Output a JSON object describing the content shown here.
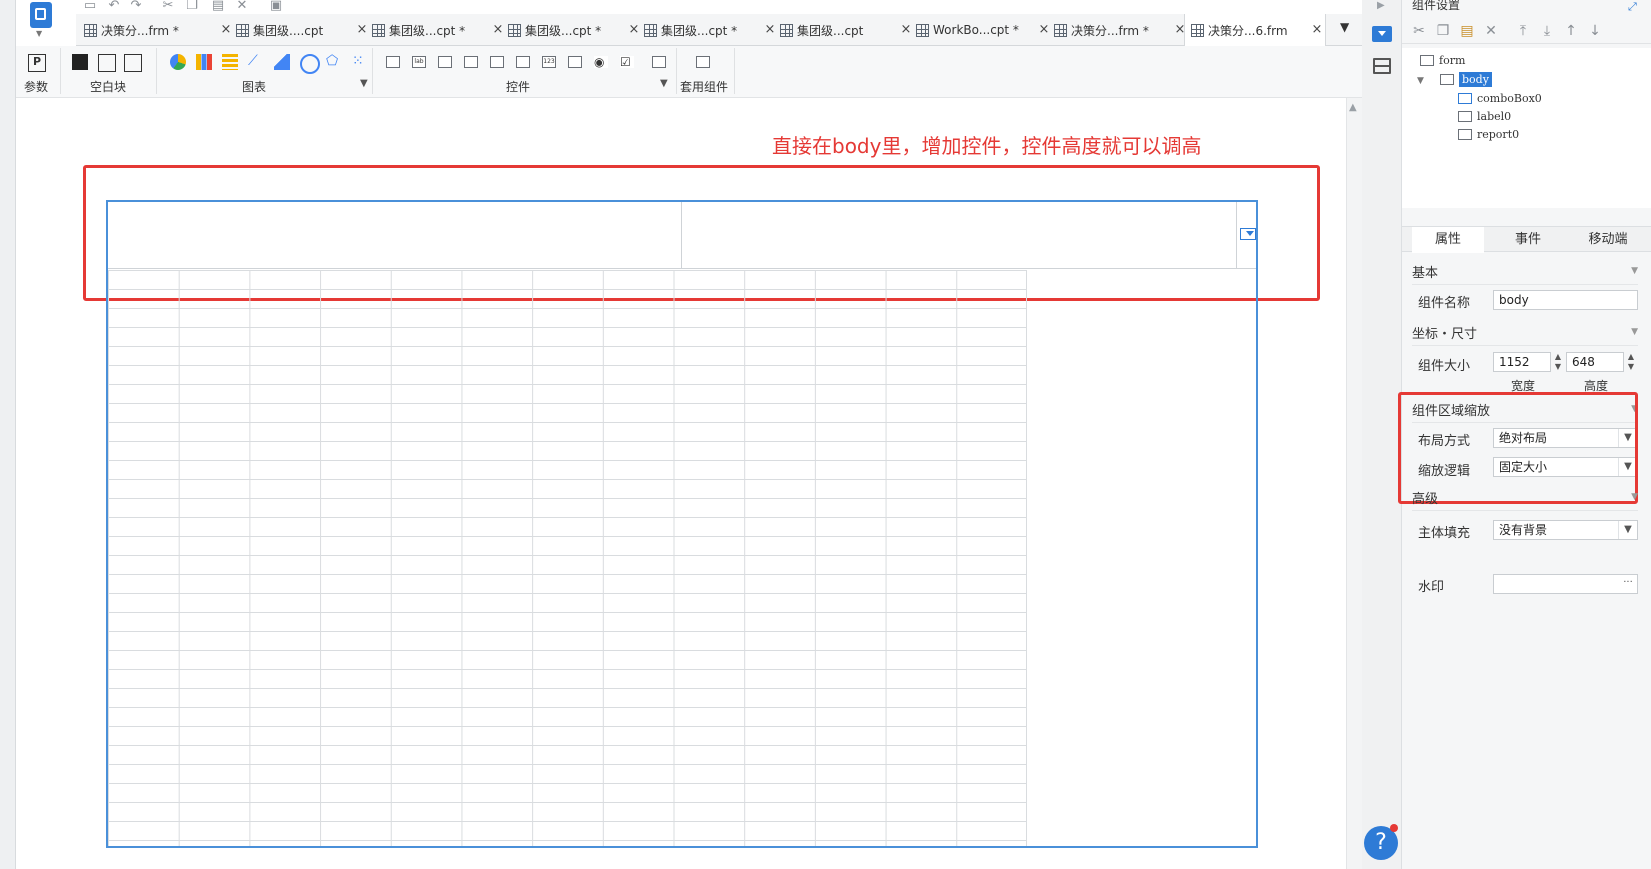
{
  "quick_access": [
    "save-icon",
    "undo-icon",
    "redo-icon",
    "cut-icon",
    "copy-icon",
    "paste-icon",
    "delete-icon",
    "preview-icon"
  ],
  "tabs": [
    {
      "label": "决策分...frm *",
      "type": "frm"
    },
    {
      "label": "集团级....cpt",
      "type": "cpt"
    },
    {
      "label": "集团级...cpt *",
      "type": "cpt"
    },
    {
      "label": "集团级...cpt *",
      "type": "cpt"
    },
    {
      "label": "集团级...cpt *",
      "type": "cpt"
    },
    {
      "label": "集团级...cpt",
      "type": "cpt"
    },
    {
      "label": "WorkBo...cpt *",
      "type": "cpt"
    },
    {
      "label": "决策分...frm *",
      "type": "frm"
    },
    {
      "label": "决策分...6.frm",
      "type": "frm",
      "active": true
    }
  ],
  "ribbon": {
    "param_label": "参数",
    "blank_label": "空白块",
    "chart_label": "图表",
    "control_label": "控件",
    "template_label": "套用组件"
  },
  "canvas": {
    "annotation": "直接在body里，增加控件，控件高度就可以调高"
  },
  "panel": {
    "title": "组件设置",
    "tree": [
      {
        "label": "form"
      },
      {
        "label": "body",
        "selected": true
      },
      {
        "label": "comboBox0"
      },
      {
        "label": "label0"
      },
      {
        "label": "report0"
      }
    ],
    "tabs": [
      "属性",
      "事件",
      "移动端"
    ],
    "sections": {
      "basic": "基本",
      "coords": "坐标・尺寸",
      "zoom": "组件区域缩放",
      "advanced": "高级"
    },
    "fields": {
      "name_label": "组件名称",
      "name_value": "body",
      "size_label": "组件大小",
      "width_value": "1152",
      "height_value": "648",
      "width_caption": "宽度",
      "height_caption": "高度",
      "layout_label": "布局方式",
      "layout_value": "绝对布局",
      "scale_label": "缩放逻辑",
      "scale_value": "固定大小",
      "fill_label": "主体填充",
      "fill_value": "没有背景",
      "watermark_label": "水印",
      "watermark_value": ""
    }
  },
  "help": "?",
  "colors": {
    "accent": "#2e7bd6",
    "annotation": "#e53935"
  }
}
